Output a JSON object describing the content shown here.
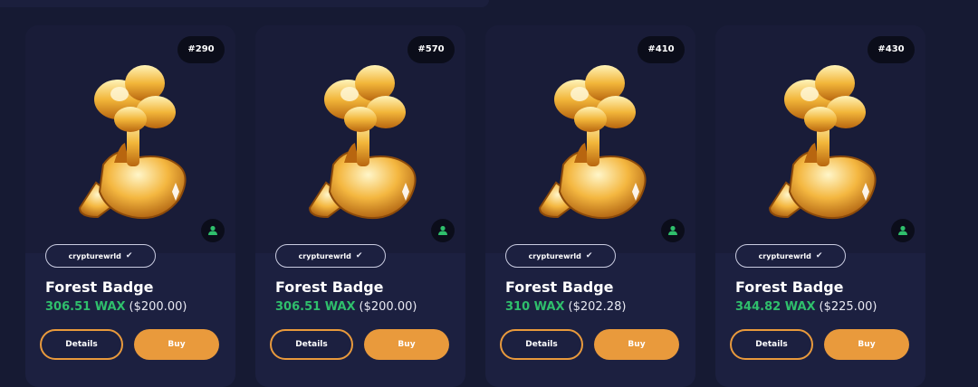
{
  "colors": {
    "page_bg": "#161a33",
    "card_bg": "#1c2040",
    "accent_orange": "#e99a3c",
    "price_green": "#2fbf6c",
    "badge_bg": "#0b0d1a",
    "owner_icon_green": "#2fbf6c"
  },
  "labels": {
    "details": "Details",
    "buy": "Buy"
  },
  "cards": [
    {
      "mint": "#290",
      "collection": "crypturewrld",
      "verified_icon": "check-icon",
      "art_icon": "golden-tree-egg-icon",
      "owner_icon": "user-icon",
      "title": "Forest Badge",
      "price_wax": "306.51 WAX",
      "price_usd": "($200.00)"
    },
    {
      "mint": "#570",
      "collection": "crypturewrld",
      "verified_icon": "check-icon",
      "art_icon": "golden-tree-egg-icon",
      "owner_icon": "user-icon",
      "title": "Forest Badge",
      "price_wax": "306.51 WAX",
      "price_usd": "($200.00)"
    },
    {
      "mint": "#410",
      "collection": "crypturewrld",
      "verified_icon": "check-icon",
      "art_icon": "golden-tree-egg-icon",
      "owner_icon": "user-icon",
      "title": "Forest Badge",
      "price_wax": "310 WAX",
      "price_usd": "($202.28)"
    },
    {
      "mint": "#430",
      "collection": "crypturewrld",
      "verified_icon": "check-icon",
      "art_icon": "golden-tree-egg-icon",
      "owner_icon": "user-icon",
      "title": "Forest Badge",
      "price_wax": "344.82 WAX",
      "price_usd": "($225.00)"
    }
  ]
}
